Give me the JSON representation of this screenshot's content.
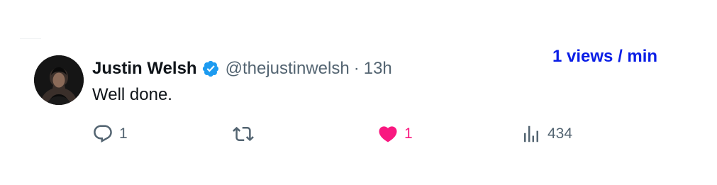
{
  "overlay": {
    "views_rate": "1 views / min"
  },
  "tweet": {
    "author_name": "Justin Welsh",
    "handle": "@thejustinwelsh",
    "separator": "·",
    "time": "13h",
    "text": "Well done.",
    "verified": true,
    "actions": {
      "reply_count": "1",
      "retweet_count": "",
      "like_count": "1",
      "liked": true,
      "view_count": "434"
    }
  },
  "colors": {
    "accent_blue": "#1d9bf0",
    "like_pink": "#f91880",
    "secondary_text": "#536471",
    "primary_text": "#0f1419",
    "overlay_blue": "#0a1ee6"
  },
  "icons": {
    "reply": "reply-icon",
    "retweet": "retweet-icon",
    "like": "heart-filled-icon",
    "views": "views-chart-icon",
    "verified": "verified-badge-icon"
  }
}
